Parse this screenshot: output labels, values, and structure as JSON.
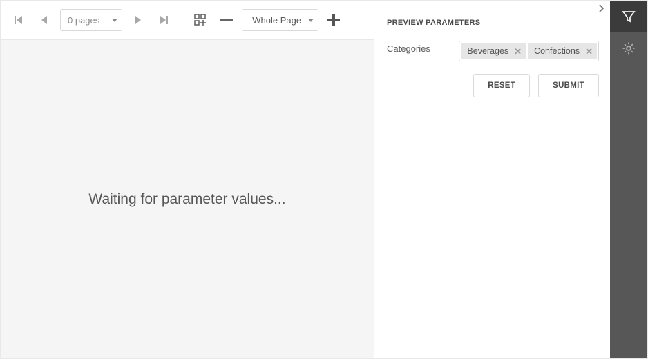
{
  "toolbar": {
    "page_label": "0 pages",
    "zoom_label": "Whole Page"
  },
  "preview": {
    "waiting_message": "Waiting for parameter values..."
  },
  "panel": {
    "header": "PREVIEW PARAMETERS",
    "param_label": "Categories",
    "tokens": [
      "Beverages",
      "Confections"
    ],
    "reset_label": "RESET",
    "submit_label": "SUBMIT"
  }
}
